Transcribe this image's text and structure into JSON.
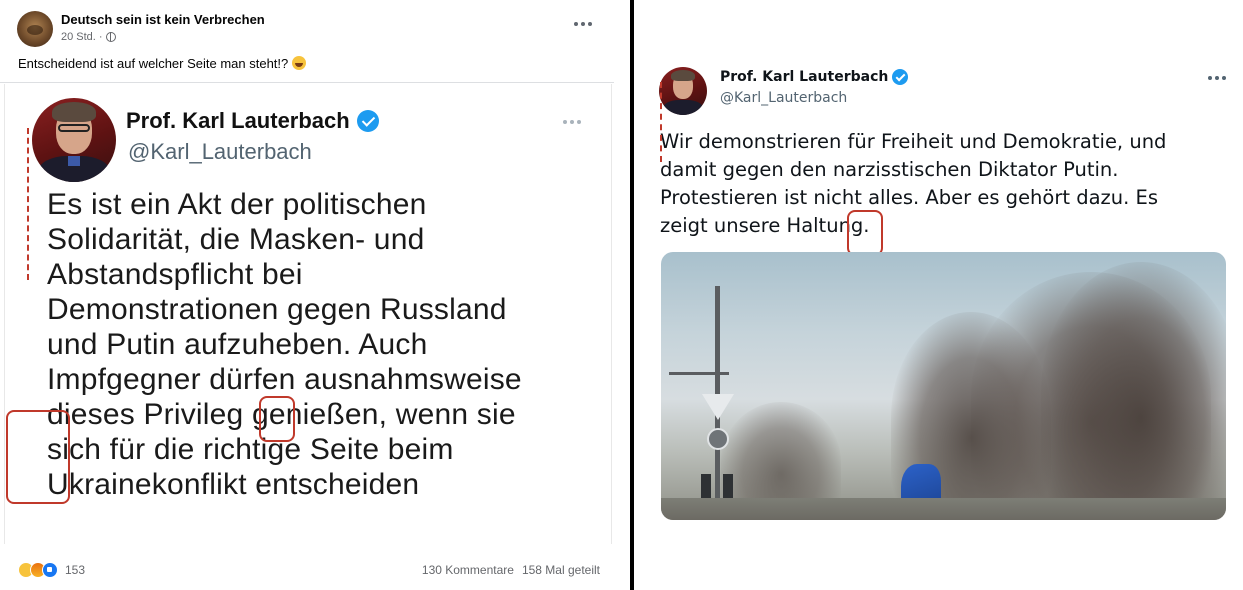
{
  "facebook_post": {
    "author": "Deutsch sein ist kein Verbrechen",
    "time": "20 Std.",
    "separator": "·",
    "caption": "Entscheidend ist auf welcher Seite man steht!?",
    "caption_emoji": "laughing-emoji",
    "embedded_tweet": {
      "name": "Prof. Karl Lauterbach",
      "handle": "@Karl_Lauterbach",
      "text": "Es ist ein Akt der politischen\nSolidarität, die Masken- und\nAbstandspflicht bei\nDemonstrationen gegen Russland\nund Putin aufzuheben. Auch\nImpfgegner dürfen ausnahmsweise\ndieses Privileg genießen, wenn sie\nsich für die richtige Seite beim\nUkrainekonflikt entscheiden"
    },
    "reactions": [
      "haha",
      "angry",
      "like"
    ],
    "reaction_count": "153",
    "comments": "130 Kommentare",
    "shares": "158 Mal geteilt"
  },
  "tweet": {
    "name": "Prof. Karl Lauterbach",
    "handle": "@Karl_Lauterbach",
    "text": "Wir demonstrieren für Freiheit und Demokratie, und\ndamit gegen den narzisstischen Diktator Putin.\nProtestieren ist nicht alles. Aber es gehört dazu. Es\nzeigt unsere Haltung."
  },
  "colors": {
    "verified": "#1d9bf0",
    "annotation_red": "#c0392b",
    "fb_secondary": "#65676b",
    "separator": "#000000"
  }
}
